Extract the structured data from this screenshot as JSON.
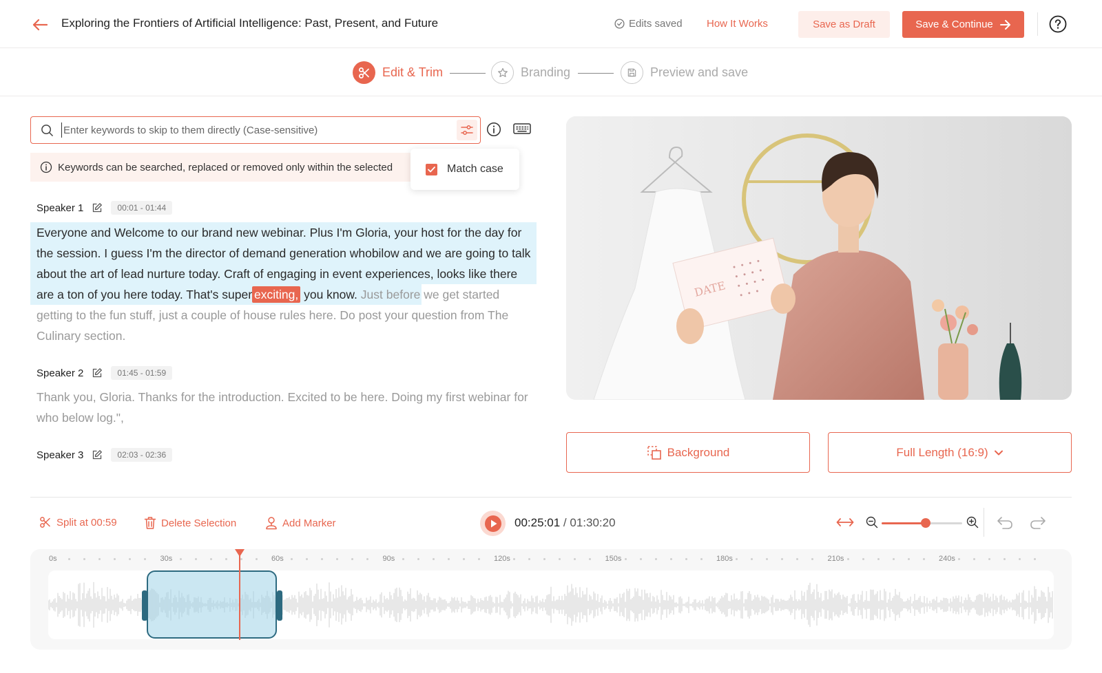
{
  "header": {
    "title": "Exploring the Frontiers of Artificial Intelligence: Past, Present, and Future",
    "edits_saved": "Edits saved",
    "how_it_works": "How It Works",
    "save_draft": "Save as Draft",
    "save_continue": "Save & Continue"
  },
  "steps": [
    {
      "label": "Edit & Trim",
      "state": "active",
      "icon": "scissors-icon"
    },
    {
      "label": "Branding",
      "state": "inactive",
      "icon": "star-icon"
    },
    {
      "label": "Preview and save",
      "state": "inactive",
      "icon": "save-icon"
    }
  ],
  "search": {
    "placeholder": "Enter keywords to skip to them directly (Case-sensitive)",
    "value": ""
  },
  "notice": "Keywords can be searched, replaced or removed only within the selected",
  "popover": {
    "match_case_label": "Match case",
    "match_case_checked": true
  },
  "transcript": [
    {
      "speaker": "Speaker 1",
      "time": "00:01 - 01:44",
      "selected_text_before": "Everyone and Welcome to our brand new webinar. Plus I'm Gloria, your host for the day for the session. I guess I'm the director of demand generation whobilow and we are going to talk about the art of lead nurture today. Craft of engaging in event experiences, looks like there are a ton of you here today. That's super",
      "keyword": "exciting,",
      "selected_text_after": " you know.",
      "rest_text": " Just before we get started getting to the fun stuff, just a couple of house rules here. Do post your question from The Culinary section."
    },
    {
      "speaker": "Speaker 2",
      "time": "01:45 - 01:59",
      "text": "Thank you, Gloria. Thanks for the introduction. Excited to be here. Doing my first webinar for who below log.\","
    },
    {
      "speaker": "Speaker 3",
      "time": "02:03 - 02:36",
      "text": ""
    }
  ],
  "preview_buttons": {
    "background": "Background",
    "aspect": "Full Length (16:9)"
  },
  "toolbar": {
    "split": "Split at 00:59",
    "delete": "Delete Selection",
    "add_marker": "Add Marker",
    "current_time": "00:25:01",
    "separator": " / ",
    "total_time": "01:30:20",
    "zoom_level": 0.55
  },
  "timeline": {
    "ruler_labels": [
      "0s",
      "30s",
      "60s",
      "90s",
      "120s",
      "150s",
      "180s",
      "210s",
      "240s"
    ],
    "selection_start_s": 26,
    "selection_end_s": 62,
    "playhead_s": 52
  },
  "colors": {
    "accent": "#e8664f",
    "accent_light": "#fdeeea",
    "highlight": "#dff3fb",
    "selection": "#2d6a80"
  }
}
